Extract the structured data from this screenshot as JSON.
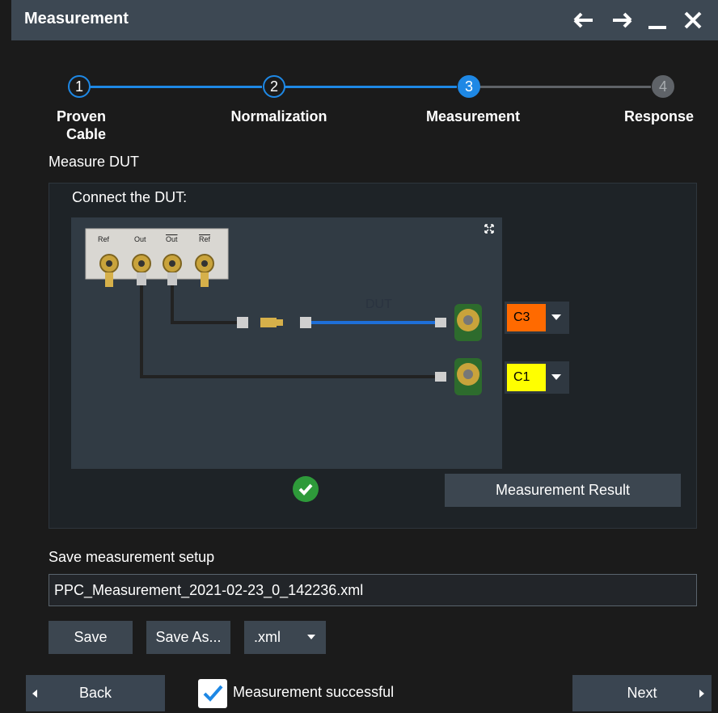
{
  "window": {
    "title": "Measurement",
    "icons": [
      "arrow-left-icon",
      "arrow-right-icon",
      "minimize-icon",
      "close-icon"
    ]
  },
  "stepper": {
    "steps": [
      {
        "number": "1",
        "label": "Proven",
        "label2": "Cable",
        "state": "done"
      },
      {
        "number": "2",
        "label": "Normalization",
        "label2": "",
        "state": "done"
      },
      {
        "number": "3",
        "label": "Measurement",
        "label2": "",
        "state": "active"
      },
      {
        "number": "4",
        "label": "Response",
        "label2": "",
        "state": "pending"
      }
    ],
    "colors": {
      "active": "#1e88e5",
      "pending": "#5f6368"
    }
  },
  "section": {
    "title": "Measure DUT",
    "instruction": "Connect the DUT:",
    "port_labels": [
      "Ref",
      "Out",
      "Out",
      "Ref"
    ],
    "dut_label": "DUT",
    "channels": [
      {
        "value": "C3",
        "color": "#ff6a00"
      },
      {
        "value": "C1",
        "color": "#ffff00"
      }
    ],
    "status_icon": "check-circle-icon",
    "result_button": "Measurement Result"
  },
  "save": {
    "label": "Save measurement setup",
    "filename": "PPC_Measurement_2021-02-23_0_142236.xml",
    "save_button": "Save",
    "save_as_button": "Save As...",
    "format_value": ".xml"
  },
  "footer": {
    "back_button": "Back",
    "checkbox_label": "Measurement successful",
    "checkbox_checked": true,
    "next_button": "Next"
  }
}
